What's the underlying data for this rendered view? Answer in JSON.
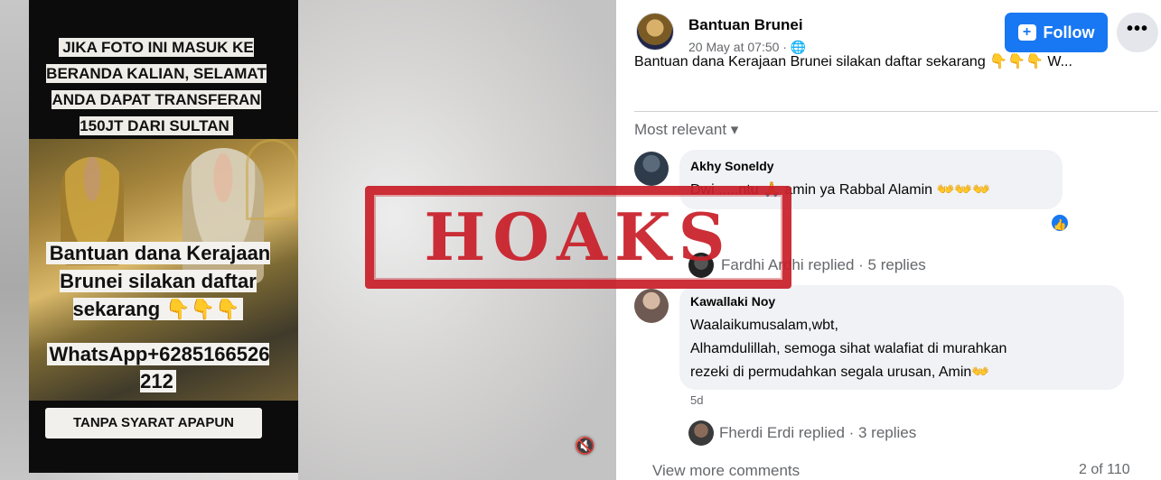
{
  "media": {
    "overlay_top": "JIKA FOTO INI MASUK KE BERANDA KALIAN, SELAMAT ANDA DAPAT TRANSFERAN 150JT DARI SULTAN",
    "overlay_mid": "Bantuan dana Kerajaan Brunei silakan daftar sekarang 👇👇👇",
    "overlay_phone": "WhatsApp+6285166526 212",
    "overlay_bottom": "TANPA SYARAT APAPUN",
    "mute_icon": "🔇"
  },
  "post": {
    "page_name": "Bantuan Brunei",
    "meta": "20 May at 07:50 · 🌐",
    "follow_label": "Follow",
    "more_label": "•••",
    "caption": "Bantuan dana Kerajaan Brunei silakan daftar sekarang 👇👇👇 W...",
    "sort_label": "Most relevant ▾"
  },
  "comments": [
    {
      "author": "Akhy Soneldy",
      "text": "Dwi .....ntu 🙏 amin ya Rabbal Alamin 👐👐👐",
      "reaction_icon": "👍",
      "reply_line": "Fardhi Ardhi replied · 5 replies"
    },
    {
      "author": "Kawallaki Noy",
      "text": "Waalaikumusalam,wbt,\nAlhamdulillah, semoga sihat walafiat di murahkan\nrezeki di permudahkan segala urusan, Amin👐",
      "time": "5d",
      "reply_line": "Fherdi Erdi replied · 3 replies"
    }
  ],
  "footer": {
    "view_more": "View more comments",
    "count": "2 of 110"
  },
  "stamp": {
    "label": "HOAKS",
    "color": "#c9202a"
  },
  "colors": {
    "accent": "#1877f2",
    "muted_text": "#65676b",
    "bubble_bg": "#f0f2f5"
  }
}
